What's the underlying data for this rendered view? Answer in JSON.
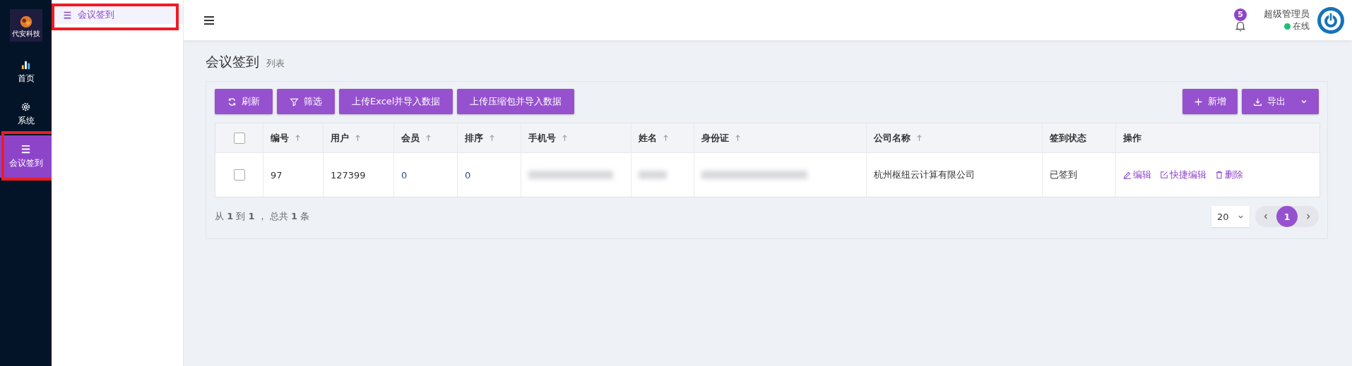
{
  "rail": {
    "items": [
      {
        "label": "首页",
        "selected": false
      },
      {
        "label": "系统",
        "selected": false
      },
      {
        "label": "会议签到",
        "selected": true
      }
    ],
    "logo_text": "代安科技"
  },
  "submenu": {
    "items": [
      {
        "label": "会议签到",
        "selected": true
      }
    ]
  },
  "header": {
    "notifications": "5",
    "user": "超级管理员",
    "status": "在线"
  },
  "page": {
    "title": "会议签到",
    "subtitle": "列表"
  },
  "toolbar": {
    "left": [
      "刷新",
      "筛选",
      "上传Excel并导入数据",
      "上传压缩包并导入数据"
    ],
    "right": [
      "新增",
      "导出"
    ]
  },
  "table": {
    "all_checked": false,
    "columns": [
      {
        "label": "编号",
        "sortable": true
      },
      {
        "label": "用户",
        "sortable": true
      },
      {
        "label": "会员",
        "sortable": true
      },
      {
        "label": "排序",
        "sortable": true
      },
      {
        "label": "手机号",
        "sortable": true
      },
      {
        "label": "姓名",
        "sortable": true
      },
      {
        "label": "身份证",
        "sortable": true
      },
      {
        "label": "公司名称",
        "sortable": true
      },
      {
        "label": "签到状态",
        "sortable": false
      },
      {
        "label": "操作",
        "sortable": false
      }
    ],
    "rows": [
      {
        "checked": false,
        "cells": [
          {
            "kind": "text",
            "text": "97"
          },
          {
            "kind": "text",
            "text": "127399"
          },
          {
            "kind": "link",
            "text": "0"
          },
          {
            "kind": "link",
            "text": "0"
          },
          {
            "kind": "blurred"
          },
          {
            "kind": "blurred"
          },
          {
            "kind": "blurred"
          },
          {
            "kind": "text",
            "text": "杭州枢纽云计算有限公司"
          },
          {
            "kind": "text",
            "text": "已签到"
          },
          {
            "kind": "actions",
            "actions": [
              "编辑",
              "快捷编辑",
              "删除"
            ]
          }
        ]
      }
    ]
  },
  "footer": {
    "summary": "从 **1** 到 **1** ， 总共 **1** 条",
    "page_size": "20",
    "pages": [
      {
        "label": "1",
        "selected": true
      }
    ]
  }
}
